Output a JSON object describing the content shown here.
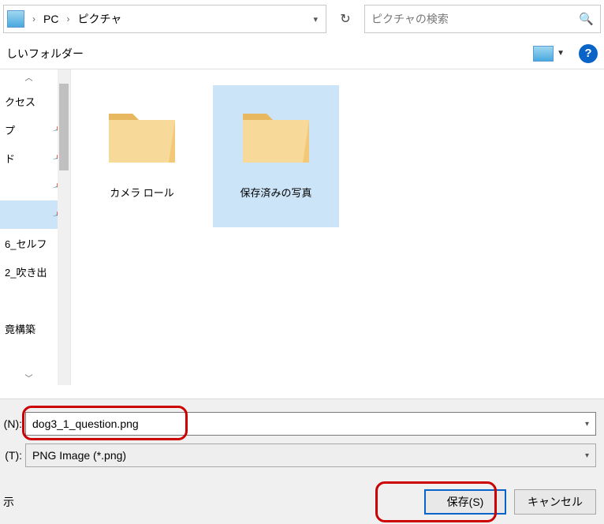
{
  "breadcrumb": {
    "pc": "PC",
    "folder": "ピクチャ"
  },
  "refresh_icon": "↻",
  "search_placeholder": "ピクチャの検索",
  "toolbar": {
    "new_folder": "しいフォルダー",
    "help": "?"
  },
  "sidebar": {
    "items": [
      {
        "label": "クセス",
        "pin": false
      },
      {
        "label": "プ",
        "pin": true
      },
      {
        "label": "ド",
        "pin": true
      },
      {
        "label": "",
        "pin": true,
        "selected": false
      },
      {
        "label": "",
        "pin": true,
        "selected": true
      },
      {
        "label": "6_セルフ",
        "pin": false
      },
      {
        "label": "2_吹き出",
        "pin": false
      },
      {
        "label": "",
        "pin": false
      },
      {
        "label": "竟構築",
        "pin": false
      }
    ]
  },
  "folders": [
    {
      "label": "カメラ ロール",
      "selected": false
    },
    {
      "label": "保存済みの写真",
      "selected": true
    }
  ],
  "form": {
    "filename_label": "(N):",
    "filename_value": "dog3_1_question.png",
    "filetype_label": "(T):",
    "filetype_value": "PNG Image (*.png)"
  },
  "actions": {
    "hide": "示",
    "save": "保存(S)",
    "cancel": "キャンセル"
  }
}
